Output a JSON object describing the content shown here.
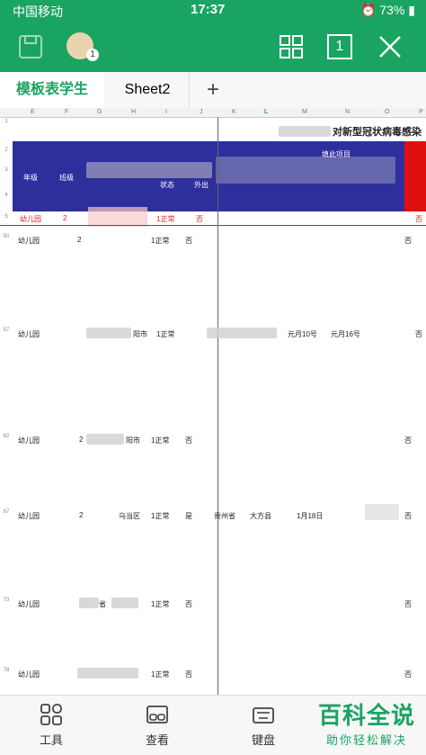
{
  "status": {
    "carrier": "中国移动",
    "time": "17:37",
    "battery": "73%"
  },
  "toolbar": {
    "badge": "1",
    "page_button": "1"
  },
  "tabs": [
    {
      "label": "模板表学生"
    },
    {
      "label": "Sheet2"
    }
  ],
  "add_tab_symbol": "+",
  "sheet": {
    "col_headers": [
      "E",
      "F",
      "G",
      "H",
      "I",
      "J",
      "K",
      "L",
      "M",
      "N",
      "O",
      "P"
    ],
    "title_text": "对新型冠状病毒感染",
    "header": {
      "grade": "年级",
      "class": "班级",
      "status": "状态",
      "out": "外出",
      "fill_item": "填此项目",
      "row_nums": [
        "1",
        "2",
        "3",
        "4",
        "5"
      ]
    },
    "row5": {
      "grade": "幼儿园",
      "class": "2",
      "status": "1正常",
      "out": "否",
      "last": "否"
    },
    "rows": [
      {
        "num": "50",
        "grade": "幼儿园",
        "class": "2",
        "loc": "",
        "status": "1正常",
        "out": "否",
        "province": "",
        "county": "",
        "d1": "",
        "d2": "",
        "last": "否"
      },
      {
        "num": "57",
        "grade": "幼儿园",
        "class": "",
        "loc": "阳市",
        "status": "1正常",
        "out": "否",
        "province": "",
        "county": "",
        "d1": "元月10号",
        "d2": "元月16号",
        "last": "否"
      },
      {
        "num": "62",
        "grade": "幼儿园",
        "class": "2",
        "loc": "阳市",
        "status": "1正常",
        "out": "否",
        "province": "",
        "county": "",
        "d1": "",
        "d2": "",
        "last": "否"
      },
      {
        "num": "67",
        "grade": "幼儿园",
        "class": "2",
        "loc": "乌当区",
        "status": "1正常",
        "out": "是",
        "province": "贵州省",
        "county": "大方县",
        "d1": "1月18日",
        "d2": "",
        "last": "否"
      },
      {
        "num": "73",
        "grade": "幼儿园",
        "class": "",
        "loc": "省",
        "status": "1正常",
        "out": "否",
        "province": "",
        "county": "",
        "d1": "",
        "d2": "",
        "last": "否"
      },
      {
        "num": "78",
        "grade": "幼儿园",
        "class": "",
        "loc": "",
        "status": "1正常",
        "out": "否",
        "province": "",
        "county": "",
        "d1": "",
        "d2": "",
        "last": "否"
      }
    ]
  },
  "bottom": [
    {
      "label": "工具"
    },
    {
      "label": "查看"
    },
    {
      "label": "键盘"
    }
  ],
  "watermark": {
    "title": "百科全说",
    "subtitle": "助你轻松解决"
  },
  "colors": {
    "accent": "#1aa462",
    "header_band": "#2e2f9c",
    "red_text": "#e02020"
  }
}
